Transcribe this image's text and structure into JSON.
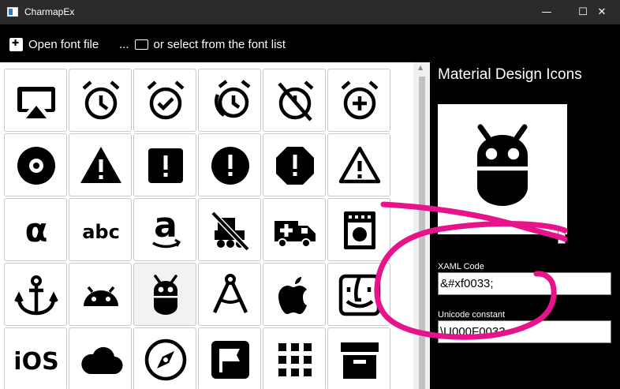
{
  "window": {
    "title": "CharmapEx",
    "minimize_glyph": "—",
    "maximize_glyph": "☐",
    "close_glyph": "✕"
  },
  "toolbar": {
    "open_label": "Open font file",
    "select_prefix": "...",
    "select_label": "or select from the font list"
  },
  "glyph_grid": {
    "selected_index": 20,
    "cells": [
      {
        "icon": "airplay-icon"
      },
      {
        "icon": "alarm-icon"
      },
      {
        "icon": "alarm-check-icon"
      },
      {
        "icon": "alarm-multiple-icon"
      },
      {
        "icon": "alarm-off-icon"
      },
      {
        "icon": "alarm-plus-icon"
      },
      {
        "icon": "album-icon"
      },
      {
        "icon": "alert-icon"
      },
      {
        "icon": "alert-box-icon"
      },
      {
        "icon": "alert-circle-icon"
      },
      {
        "icon": "alert-octagon-icon"
      },
      {
        "icon": "alert-outline-icon"
      },
      {
        "icon": "alpha-icon",
        "text": "α"
      },
      {
        "icon": "alphabetical-icon",
        "text": "abc"
      },
      {
        "icon": "amazon-icon",
        "text": "a"
      },
      {
        "icon": "ambulance-off-icon"
      },
      {
        "icon": "ambulance-icon"
      },
      {
        "icon": "amplifier-icon"
      },
      {
        "icon": "anchor-icon"
      },
      {
        "icon": "android-icon"
      },
      {
        "icon": "android-debug-bridge-icon"
      },
      {
        "icon": "angular-icon"
      },
      {
        "icon": "apple-icon"
      },
      {
        "icon": "apple-finder-icon"
      },
      {
        "icon": "apple-ios-icon",
        "text": "iOS"
      },
      {
        "icon": "apple-keyboard-icon"
      },
      {
        "icon": "apple-safari-icon"
      },
      {
        "icon": "application-icon"
      },
      {
        "icon": "apps-icon"
      },
      {
        "icon": "archive-icon"
      }
    ]
  },
  "details": {
    "font_name": "Material Design Icons",
    "preview_icon": "android-debug-bridge-icon",
    "size_slider_value": 1.0,
    "xaml_label": "XAML Code",
    "xaml_value": "&#xf0033;",
    "unicode_label": "Unicode constant",
    "unicode_value": "\\U000F0033"
  },
  "colors": {
    "annotation": "#e6138a",
    "window_bg": "#000000",
    "grid_bg": "#ffffff"
  }
}
